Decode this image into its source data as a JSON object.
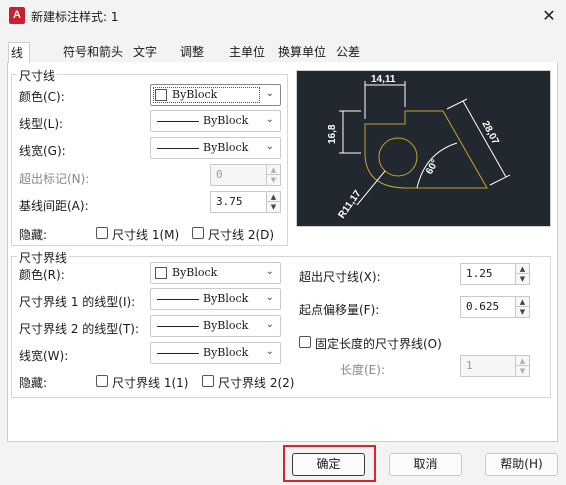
{
  "window": {
    "title": "新建标注样式: 1",
    "app_icon_letter": "A",
    "close_glyph": "✕"
  },
  "tabs": [
    {
      "label": "线",
      "active": true
    },
    {
      "label": "符号和箭头"
    },
    {
      "label": "文字"
    },
    {
      "label": "调整"
    },
    {
      "label": "主单位"
    },
    {
      "label": "换算单位"
    },
    {
      "label": "公差"
    }
  ],
  "dim_lines": {
    "title": "尺寸线",
    "color_label": "颜色(C):",
    "color_value": "ByBlock",
    "linetype_label": "线型(L):",
    "linetype_value": "ByBlock",
    "lineweight_label": "线宽(G):",
    "lineweight_value": "ByBlock",
    "extend_ticks_label": "超出标记(N):",
    "extend_ticks_value": "0",
    "baseline_spacing_label": "基线间距(A):",
    "baseline_spacing_value": "3.75",
    "suppress_label": "隐藏:",
    "suppress_1": "尺寸线 1(M)",
    "suppress_2": "尺寸线 2(D)"
  },
  "ext_lines": {
    "title": "尺寸界线",
    "color_label": "颜色(R):",
    "color_value": "ByBlock",
    "linetype1_label": "尺寸界线 1 的线型(I):",
    "linetype1_value": "ByBlock",
    "linetype2_label": "尺寸界线 2 的线型(T):",
    "linetype2_value": "ByBlock",
    "lineweight_label": "线宽(W):",
    "lineweight_value": "ByBlock",
    "suppress_label": "隐藏:",
    "suppress_1": "尺寸界线 1(1)",
    "suppress_2": "尺寸界线 2(2)",
    "extend_beyond_label": "超出尺寸线(X):",
    "extend_beyond_value": "1.25",
    "offset_label": "起点偏移量(F):",
    "offset_value": "0.625",
    "fixed_length_label": "固定长度的尺寸界线(O)",
    "length_label": "长度(E):",
    "length_value": "1"
  },
  "preview": {
    "dim_top": "14,11",
    "dim_left": "16,8",
    "dim_right": "28,07",
    "dim_angle": "60°",
    "dim_radius": "R11,17",
    "bg_color": "#212830",
    "line_color": "#ffffff",
    "shape_color": "#c9a227"
  },
  "buttons": {
    "ok": "确定",
    "cancel": "取消",
    "help": "帮助(H)"
  }
}
